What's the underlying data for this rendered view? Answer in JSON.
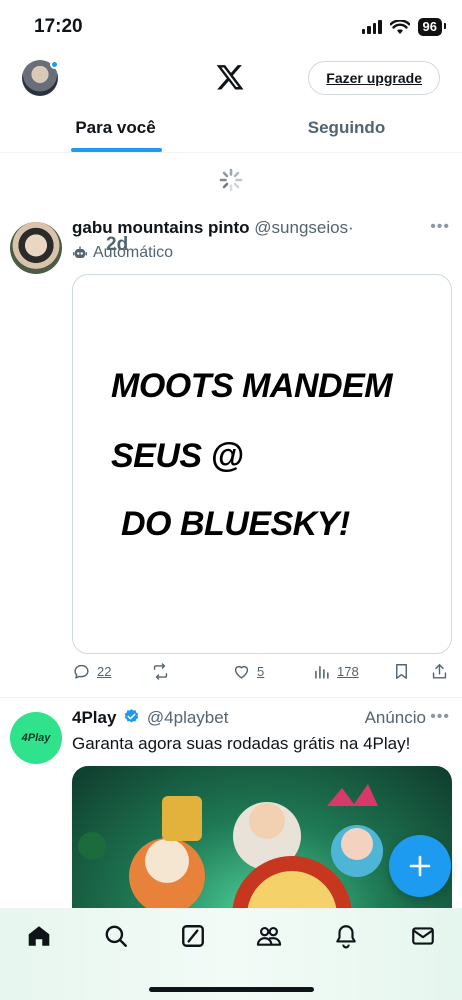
{
  "status_bar": {
    "time": "17:20",
    "battery": "96"
  },
  "header": {
    "upgrade_label": "Fazer upgrade"
  },
  "tabs": [
    {
      "label": "Para você",
      "active": true
    },
    {
      "label": "Seguindo",
      "active": false
    }
  ],
  "post1": {
    "name": "gabu mountains pinto",
    "handle": "@sungseios",
    "separator": "·",
    "time": "2d",
    "automated_label": "Automático",
    "image_text": [
      "MOOTS MANDEM",
      "SEUS @",
      "DO BLUESKY!"
    ],
    "actions": {
      "replies": "22",
      "likes": "5",
      "views": "178"
    }
  },
  "post2": {
    "name": "4Play",
    "handle": "@4playbet",
    "badge": "Anúncio",
    "text": "Garanta agora suas rodadas grátis na 4Play!",
    "avatar_text": "4Play"
  },
  "colors": {
    "accent": "#1d9bf0",
    "muted": "#536471",
    "ad_avatar": "#2fe28b"
  },
  "icons": [
    "home-icon",
    "search-icon",
    "grok-icon",
    "communities-icon",
    "notifications-icon",
    "messages-icon"
  ]
}
